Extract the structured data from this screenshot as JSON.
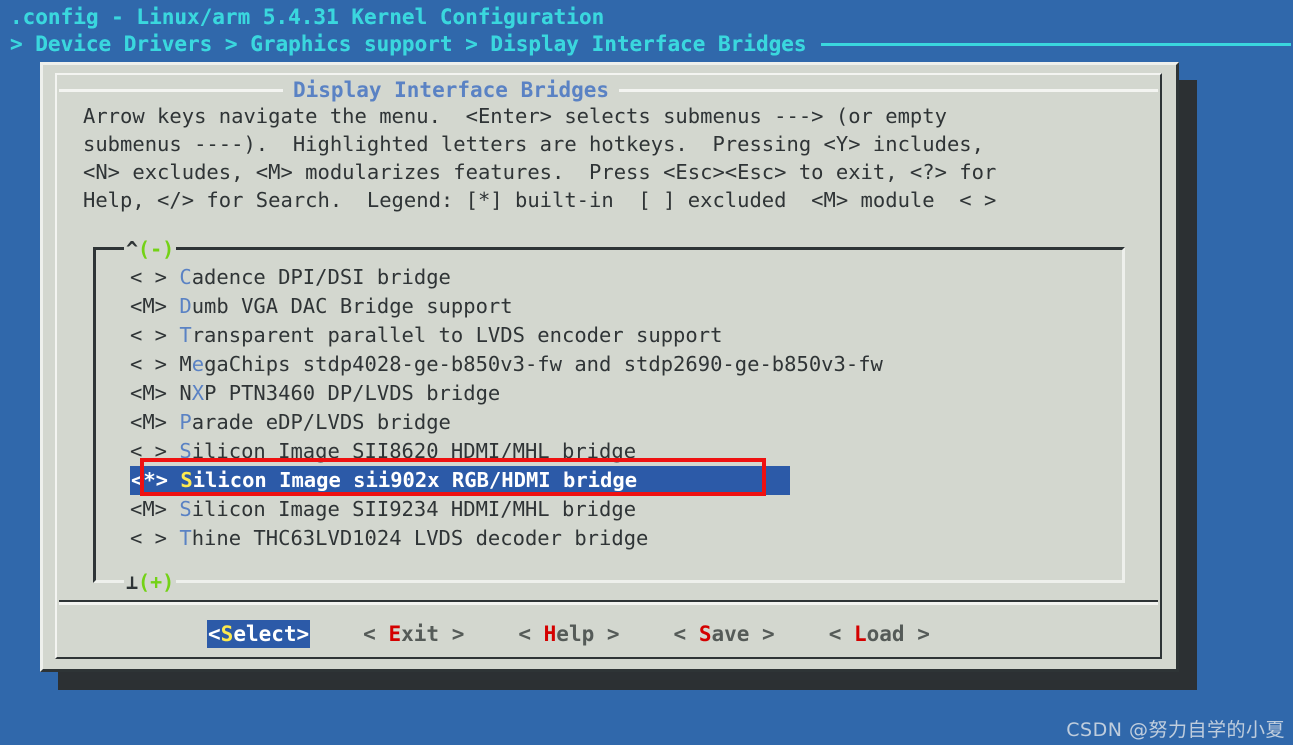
{
  "header": {
    "title": ".config - Linux/arm 5.4.31 Kernel Configuration",
    "breadcrumb": "> Device Drivers > Graphics support > Display Interface Bridges"
  },
  "dialog": {
    "title": "Display Interface Bridges",
    "help_lines": [
      "Arrow keys navigate the menu.  <Enter> selects submenus ---> (or empty",
      "submenus ----).  Highlighted letters are hotkeys.  Pressing <Y> includes,",
      "<N> excludes, <M> modularizes features.  Press <Esc><Esc> to exit, <?> for",
      "Help, </> for Search.  Legend: [*] built-in  [ ] excluded  <M> module  < >"
    ]
  },
  "listbox": {
    "scroll_up_indicator": "^(-)",
    "scroll_down_indicator": "⊥(+)",
    "items": [
      {
        "state": "< > ",
        "pre": "",
        "hot": "C",
        "post": "adence DPI/DSI bridge",
        "selected": false
      },
      {
        "state": "<M> ",
        "pre": "",
        "hot": "D",
        "post": "umb VGA DAC Bridge support",
        "selected": false
      },
      {
        "state": "< > ",
        "pre": "",
        "hot": "T",
        "post": "ransparent parallel to LVDS encoder support",
        "selected": false
      },
      {
        "state": "< > ",
        "pre": "M",
        "hot": "e",
        "post": "gaChips stdp4028-ge-b850v3-fw and stdp2690-ge-b850v3-fw",
        "selected": false
      },
      {
        "state": "<M> ",
        "pre": "N",
        "hot": "X",
        "post": "P PTN3460 DP/LVDS bridge",
        "selected": false
      },
      {
        "state": "<M> ",
        "pre": "",
        "hot": "P",
        "post": "arade eDP/LVDS bridge",
        "selected": false
      },
      {
        "state": "< > ",
        "pre": "",
        "hot": "S",
        "post": "ilicon Image SII8620 HDMI/MHL bridge",
        "selected": false
      },
      {
        "state": "<*> ",
        "pre": "",
        "hot": "S",
        "post": "ilicon Image sii902x RGB/HDMI bridge",
        "selected": true
      },
      {
        "state": "<M> ",
        "pre": "",
        "hot": "S",
        "post": "ilicon Image SII9234 HDMI/MHL bridge",
        "selected": false
      },
      {
        "state": "< > ",
        "pre": "",
        "hot": "T",
        "post": "hine THC63LVD1024 LVDS decoder bridge",
        "selected": false
      }
    ]
  },
  "buttons": [
    {
      "pre": "<",
      "hot": "S",
      "post": "elect>",
      "active": true
    },
    {
      "pre": "< ",
      "hot": "E",
      "post": "xit >",
      "active": false
    },
    {
      "pre": "< ",
      "hot": "H",
      "post": "elp >",
      "active": false
    },
    {
      "pre": "< ",
      "hot": "S",
      "post": "ave >",
      "active": false
    },
    {
      "pre": "< ",
      "hot": "L",
      "post": "oad >",
      "active": false
    }
  ],
  "watermark": "CSDN @努力自学的小夏",
  "colors": {
    "terminal_background": "#3068ab",
    "header_text": "#3ad7de",
    "dialog_background": "#d3d7cf",
    "dialog_title": "#5a82c4",
    "body_text": "#2f3436",
    "hotkey": "#5a82c4",
    "selection_background": "#2c5aa8",
    "selection_hotkey": "#fce94f",
    "button_hotkey": "#d40000",
    "scroll_indicator": "#73d216",
    "annotation": "#ee1111",
    "shadow": "#2c3033"
  }
}
